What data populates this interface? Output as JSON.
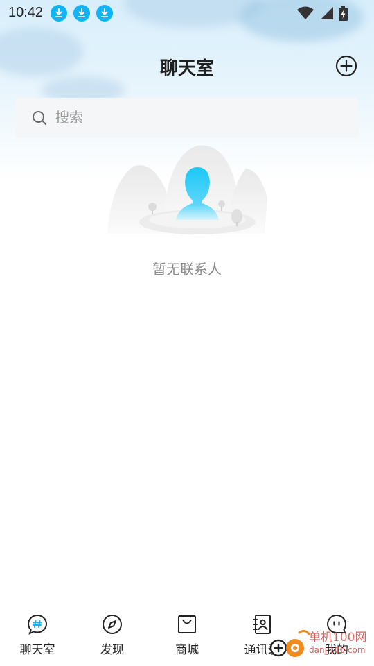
{
  "status_bar": {
    "time": "10:42",
    "notifications": [
      "download-icon",
      "download-icon",
      "download-icon"
    ],
    "icons": [
      "wifi-icon",
      "signal-icon",
      "battery-charging-icon"
    ],
    "accent": "#11b4f5"
  },
  "header": {
    "title": "聊天室",
    "add_icon": "plus-circle-icon"
  },
  "search": {
    "placeholder": "搜索",
    "value": ""
  },
  "empty_state": {
    "text": "暂无联系人",
    "illustration": "person-on-mountain-illustration"
  },
  "tab_bar": {
    "items": [
      {
        "label": "聊天室",
        "icon": "chat-hash-icon",
        "active": true
      },
      {
        "label": "发现",
        "icon": "compass-icon",
        "active": false
      },
      {
        "label": "商城",
        "icon": "shopping-bag-icon",
        "active": false
      },
      {
        "label": "通讯录",
        "icon": "contacts-book-icon",
        "active": false
      },
      {
        "label": "我的",
        "icon": "face-bubble-icon",
        "active": false
      }
    ],
    "active_color": "#11b4f5"
  },
  "watermark": {
    "line1": "单机100网",
    "line2": "danji100.com"
  }
}
